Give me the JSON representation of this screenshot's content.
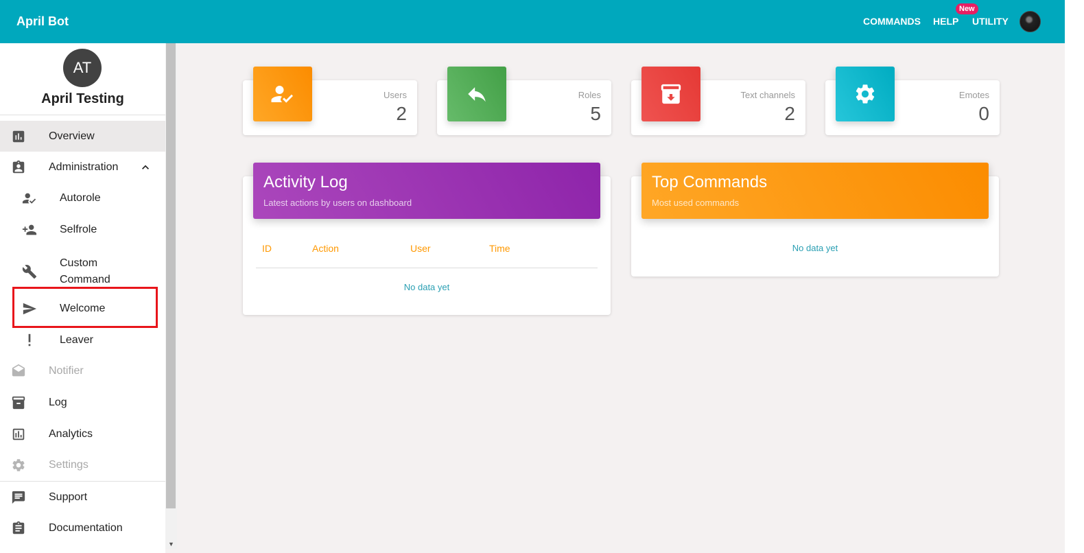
{
  "app": {
    "title": "April Bot"
  },
  "topnav": {
    "commands": "COMMANDS",
    "help": "HELP",
    "utility": "UTILITY",
    "new_badge": "New"
  },
  "workspace": {
    "initials": "AT",
    "name": "April Testing"
  },
  "sidebar": {
    "items": [
      {
        "label": "Overview",
        "icon": "bar-chart-icon"
      },
      {
        "label": "Administration",
        "icon": "clipboard-account-icon"
      },
      {
        "label": "Autorole",
        "icon": "account-check-icon"
      },
      {
        "label": "Selfrole",
        "icon": "account-plus-icon"
      },
      {
        "label": "Custom Command",
        "icon": "wrench-icon"
      },
      {
        "label": "Welcome",
        "icon": "send-icon"
      },
      {
        "label": "Leaver",
        "icon": "exclamation-icon"
      },
      {
        "label": "Notifier",
        "icon": "envelope-open-icon"
      },
      {
        "label": "Log",
        "icon": "archive-icon"
      },
      {
        "label": "Analytics",
        "icon": "poll-icon"
      },
      {
        "label": "Settings",
        "icon": "gear-icon"
      },
      {
        "label": "Support",
        "icon": "message-icon"
      },
      {
        "label": "Documentation",
        "icon": "clipboard-text-icon"
      }
    ]
  },
  "stats": [
    {
      "label": "Users",
      "value": "2",
      "color": "#ff9800",
      "icon": "account-check-icon"
    },
    {
      "label": "Roles",
      "value": "5",
      "color": "#4caf50",
      "icon": "reply-icon"
    },
    {
      "label": "Text channels",
      "value": "2",
      "color": "#e53935",
      "icon": "archive-icon"
    },
    {
      "label": "Emotes",
      "value": "0",
      "color": "#00bcd4",
      "icon": "gear-icon"
    }
  ],
  "activity_log": {
    "title": "Activity Log",
    "subtitle": "Latest actions by users on dashboard",
    "columns": [
      "ID",
      "Action",
      "User",
      "Time"
    ],
    "empty": "No data yet",
    "color": "#9c27b0"
  },
  "top_commands": {
    "title": "Top Commands",
    "subtitle": "Most used commands",
    "empty": "No data yet",
    "color": "#ff9800"
  }
}
